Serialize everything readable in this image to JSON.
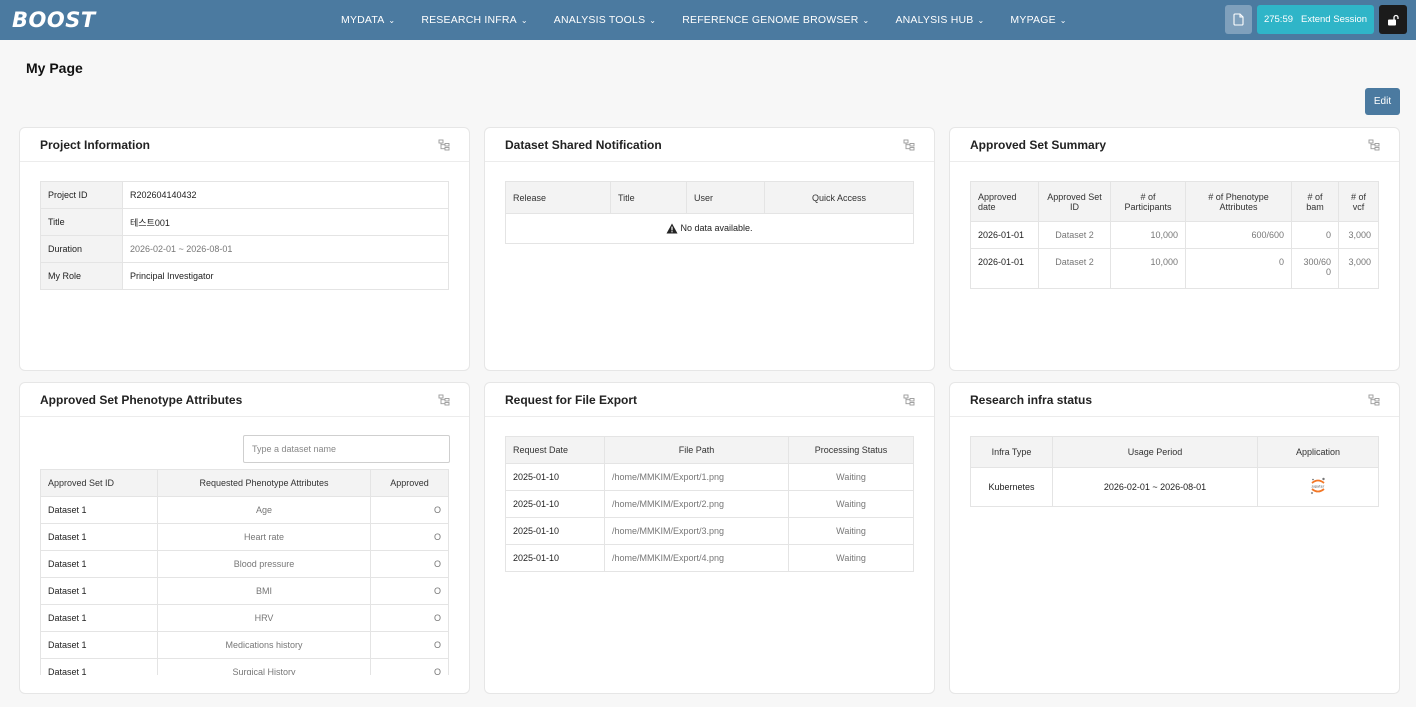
{
  "header": {
    "logo_text": "BOOST",
    "nav": [
      {
        "label": "MYDATA"
      },
      {
        "label": "RESEARCH INFRA"
      },
      {
        "label": "ANALYSIS TOOLS"
      },
      {
        "label": "REFERENCE GENOME BROWSER"
      },
      {
        "label": "ANALYSIS HUB"
      },
      {
        "label": "MYPAGE"
      }
    ],
    "session_time": "275:59",
    "session_label": "Extend Session"
  },
  "page": {
    "title": "My Page",
    "edit_label": "Edit"
  },
  "project_info": {
    "title": "Project Information",
    "rows": [
      {
        "key": "Project ID",
        "value": "R202604140432"
      },
      {
        "key": "Title",
        "value": "테스트001"
      },
      {
        "key": "Duration",
        "value": "2026-02-01 ~ 2026-08-01"
      },
      {
        "key": "My Role",
        "value": "Principal Investigator"
      }
    ]
  },
  "dataset_shared": {
    "title": "Dataset Shared Notification",
    "columns": [
      "Release",
      "Title",
      "User",
      "Quick Access"
    ],
    "empty_text": "No data available."
  },
  "approved_summary": {
    "title": "Approved Set Summary",
    "columns": [
      "Approved date",
      "Approved Set ID",
      "# of Participants",
      "# of Phenotype Attributes",
      "# of bam",
      "# of vcf"
    ],
    "rows": [
      [
        "2026-01-01",
        "Dataset 2",
        "10,000",
        "600/600",
        "0",
        "3,000"
      ],
      [
        "2026-01-01",
        "Dataset 2",
        "10,000",
        "0",
        "300/600",
        "3,000"
      ]
    ]
  },
  "phenotype": {
    "title": "Approved Set Phenotype Attributes",
    "search_placeholder": "Type a dataset name",
    "columns": [
      "Approved Set ID",
      "Requested Phenotype Attributes",
      "Approved"
    ],
    "rows": [
      [
        "Dataset 1",
        "Age",
        "O"
      ],
      [
        "Dataset 1",
        "Heart rate",
        "O"
      ],
      [
        "Dataset 1",
        "Blood pressure",
        "O"
      ],
      [
        "Dataset 1",
        "BMI",
        "O"
      ],
      [
        "Dataset 1",
        "HRV",
        "O"
      ],
      [
        "Dataset 1",
        "Medications history",
        "O"
      ],
      [
        "Dataset 1",
        "Surgical History",
        "O"
      ]
    ]
  },
  "file_export": {
    "title": "Request for File Export",
    "columns": [
      "Request Date",
      "File Path",
      "Processing Status"
    ],
    "rows": [
      [
        "2025-01-10",
        "/home/MMKIM/Export/1.png",
        "Waiting"
      ],
      [
        "2025-01-10",
        "/home/MMKIM/Export/2.png",
        "Waiting"
      ],
      [
        "2025-01-10",
        "/home/MMKIM/Export/3.png",
        "Waiting"
      ],
      [
        "2025-01-10",
        "/home/MMKIM/Export/4.png",
        "Waiting"
      ]
    ]
  },
  "infra_status": {
    "title": "Research infra status",
    "columns": [
      "Infra Type",
      "Usage Period",
      "Application"
    ],
    "rows": [
      {
        "type": "Kubernetes",
        "period": "2026-02-01 ~ 2026-08-01",
        "app_icon": "jupyter-icon"
      }
    ]
  },
  "colors": {
    "header_bg": "#4b7aa0",
    "session_bg": "#2fb5c8",
    "lock_bg": "#1b1b1b"
  }
}
